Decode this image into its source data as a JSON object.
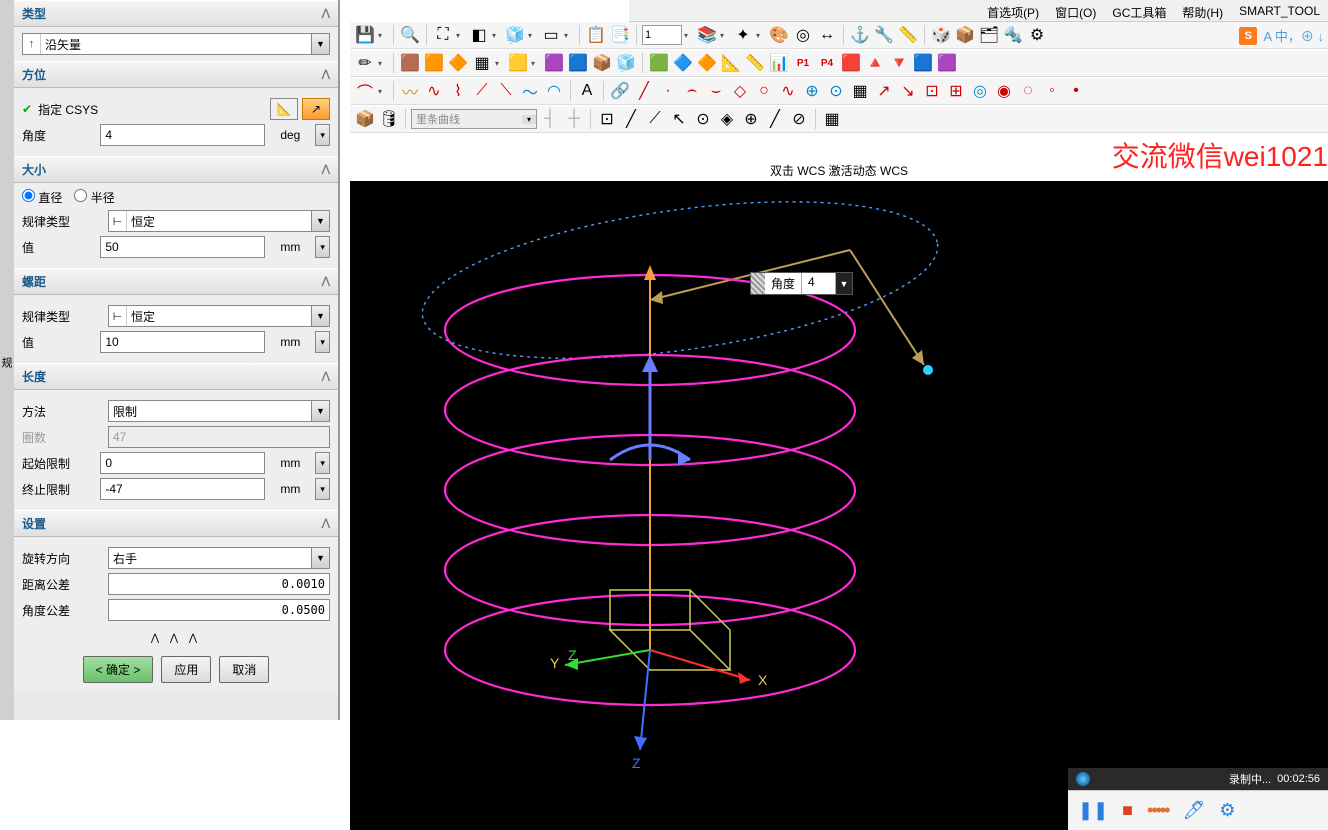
{
  "menu": {
    "items": [
      "首选项(P)",
      "窗口(O)",
      "GC工具箱",
      "帮助(H)",
      "SMART_TOOL"
    ]
  },
  "panel": {
    "type": {
      "header": "类型",
      "select": {
        "icon": "↑",
        "text": "沿矢量"
      }
    },
    "orient": {
      "header": "方位",
      "csys_label": "指定 CSYS",
      "angle_label": "角度",
      "angle_val": "4",
      "angle_unit": "deg"
    },
    "size": {
      "header": "大小",
      "diameter": "直径",
      "radius": "半径",
      "law_label": "规律类型",
      "law_val": "恒定",
      "val_label": "值",
      "val": "50",
      "unit": "mm"
    },
    "pitch": {
      "header": "螺距",
      "law_label": "规律类型",
      "law_val": "恒定",
      "val_label": "值",
      "val": "10",
      "unit": "mm"
    },
    "length": {
      "header": "长度",
      "method_label": "方法",
      "method_val": "限制",
      "turns_label": "圈数",
      "turns_val": "47",
      "start_label": "起始限制",
      "start_val": "0",
      "start_unit": "mm",
      "end_label": "终止限制",
      "end_val": "-47",
      "end_unit": "mm"
    },
    "settings": {
      "header": "设置",
      "rot_label": "旋转方向",
      "rot_val": "右手",
      "dtol_label": "距离公差",
      "dtol_val": "0.0010",
      "atol_label": "角度公差",
      "atol_val": "0.0500"
    },
    "buttons": {
      "ok": "< 确定 >",
      "apply": "应用",
      "cancel": "取消"
    }
  },
  "toolbar3": {
    "combo_placeholder": "里条曲线",
    "num": "1"
  },
  "viewport": {
    "title": "双击 WCS 激活动态 WCS",
    "watermark": "交流微信wei1021",
    "annot": {
      "label": "角度",
      "value": "4"
    },
    "axes": {
      "x": "X",
      "y": "Y",
      "z": "Z",
      "zneg": "Z"
    }
  },
  "ime": {
    "text": "A 中，⊕ ↓"
  },
  "recording": {
    "text": "录制中...",
    "time": "00:02:56"
  },
  "left_tab": "规"
}
